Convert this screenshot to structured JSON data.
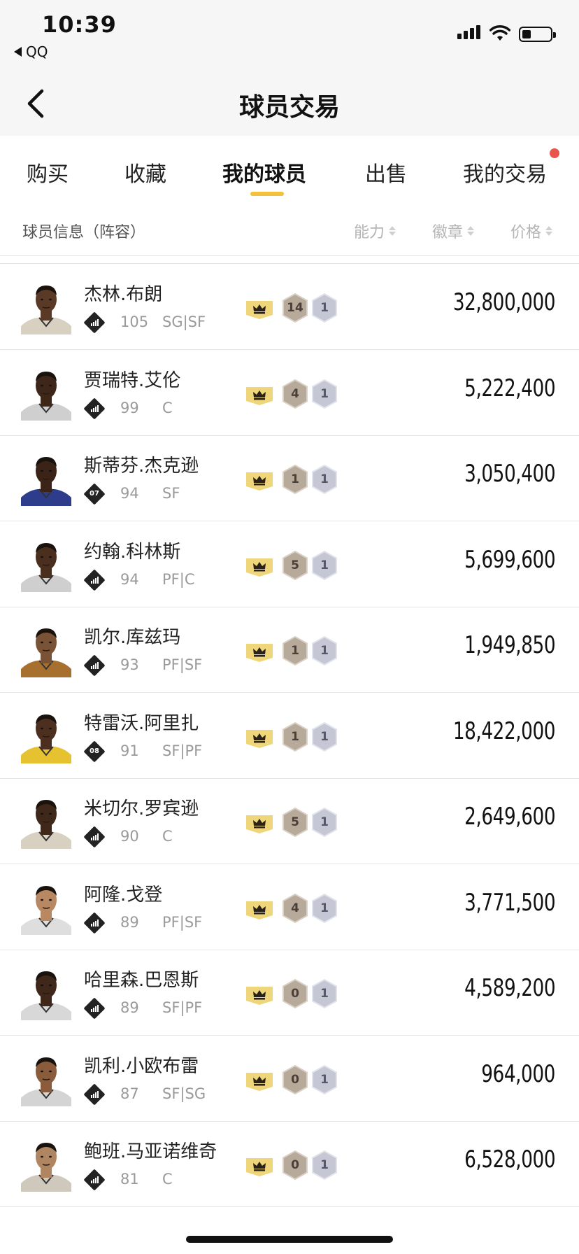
{
  "status": {
    "time": "10:39",
    "back_app": "QQ"
  },
  "nav": {
    "title": "球员交易"
  },
  "tabs": [
    {
      "label": "购买"
    },
    {
      "label": "收藏"
    },
    {
      "label": "我的球员"
    },
    {
      "label": "出售"
    },
    {
      "label": "我的交易"
    }
  ],
  "active_tab": "我的球员",
  "header": {
    "info": "球员信息（阵容）",
    "ability": "能力",
    "badge": "徽章",
    "price": "价格"
  },
  "colors": {
    "accent": "#f3c13a",
    "notify_dot": "#e8554b",
    "bronze_badge": "#b8aa9b",
    "silver_badge": "#c5c8d4"
  },
  "players": [
    {
      "name": "杰林.布朗",
      "ability": "105",
      "pos": "SG|SF",
      "icon": "bars",
      "bronze": "14",
      "silver": "1",
      "price": "32,800,000",
      "skin": "#5a3a26",
      "jersey": "#d8d0c0"
    },
    {
      "name": "贾瑞特.艾伦",
      "ability": "99",
      "pos": "C",
      "icon": "bars",
      "bronze": "4",
      "silver": "1",
      "price": "5,222,400",
      "skin": "#3e2618",
      "jersey": "#cfcfcf"
    },
    {
      "name": "斯蒂芬.杰克逊",
      "ability": "94",
      "pos": "SF",
      "icon": "07",
      "bronze": "1",
      "silver": "1",
      "price": "3,050,400",
      "skin": "#3b2417",
      "jersey": "#2e3c8c"
    },
    {
      "name": "约翰.科林斯",
      "ability": "94",
      "pos": "PF|C",
      "icon": "bars",
      "bronze": "5",
      "silver": "1",
      "price": "5,699,600",
      "skin": "#4a2e1e",
      "jersey": "#cfcfcf"
    },
    {
      "name": "凯尔.库兹玛",
      "ability": "93",
      "pos": "PF|SF",
      "icon": "bars",
      "bronze": "1",
      "silver": "1",
      "price": "1,949,850",
      "skin": "#7a5336",
      "jersey": "#a8702e"
    },
    {
      "name": "特雷沃.阿里扎",
      "ability": "91",
      "pos": "SF|PF",
      "icon": "08",
      "bronze": "1",
      "silver": "1",
      "price": "18,422,000",
      "skin": "#4d2f1f",
      "jersey": "#e7c230"
    },
    {
      "name": "米切尔.罗宾逊",
      "ability": "90",
      "pos": "C",
      "icon": "bars",
      "bronze": "5",
      "silver": "1",
      "price": "2,649,600",
      "skin": "#3f2719",
      "jersey": "#d8d0c0"
    },
    {
      "name": "阿隆.戈登",
      "ability": "89",
      "pos": "PF|SF",
      "icon": "bars",
      "bronze": "4",
      "silver": "1",
      "price": "3,771,500",
      "skin": "#b88862",
      "jersey": "#dedede"
    },
    {
      "name": "哈里森.巴恩斯",
      "ability": "89",
      "pos": "SF|PF",
      "icon": "bars",
      "bronze": "0",
      "silver": "1",
      "price": "4,589,200",
      "skin": "#3f2719",
      "jersey": "#d8d8d8"
    },
    {
      "name": "凯利.小欧布雷",
      "ability": "87",
      "pos": "SF|SG",
      "icon": "bars",
      "bronze": "0",
      "silver": "1",
      "price": "964,000",
      "skin": "#8a5c3c",
      "jersey": "#d4d4d4"
    },
    {
      "name": "鲍班.马亚诺维奇",
      "ability": "81",
      "pos": "C",
      "icon": "bars",
      "bronze": "0",
      "silver": "1",
      "price": "6,528,000",
      "skin": "#b08562",
      "jersey": "#cfc8bd"
    }
  ]
}
